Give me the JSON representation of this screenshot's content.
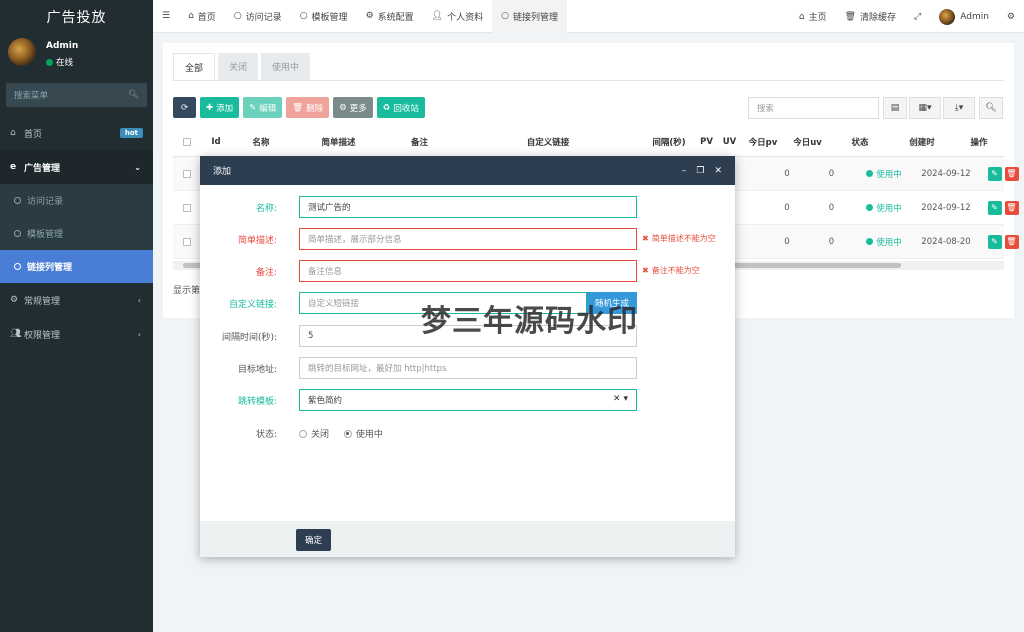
{
  "sidebar": {
    "logo": "广告投放",
    "user_name": "Admin",
    "user_status": "在线",
    "search_placeholder": "搜索菜单",
    "items": [
      {
        "label": "首页",
        "badge": "hot"
      },
      {
        "label": "广告管理"
      },
      {
        "label": "常规管理"
      },
      {
        "label": "权限管理"
      }
    ],
    "sub_items": [
      "访问记录",
      "模板管理",
      "链接列管理"
    ]
  },
  "topbar": {
    "tabs": [
      "首页",
      "访问记录",
      "模板管理",
      "系统配置",
      "个人资料",
      "链接列管理"
    ],
    "right": {
      "home": "主页",
      "clear_cache": "清除缓存",
      "user": "Admin"
    }
  },
  "content": {
    "tabs": [
      "全部",
      "关闭",
      "使用中"
    ],
    "toolbar": {
      "add": "添加",
      "edit": "编辑",
      "delete": "删除",
      "more": "更多",
      "recycle": "回收站"
    },
    "search_placeholder": "搜索",
    "columns": [
      "Id",
      "名称",
      "简单描述",
      "备注",
      "自定义链接",
      "间隔(秒)",
      "PV",
      "UV",
      "今日pv",
      "今日uv",
      "状态",
      "创建时",
      "操作"
    ],
    "rows": [
      {
        "today_pv": "0",
        "today_uv": "0",
        "status": "使用中",
        "created": "2024-09-12"
      },
      {
        "today_pv": "0",
        "today_uv": "0",
        "status": "使用中",
        "created": "2024-09-12"
      },
      {
        "today_pv": "0",
        "today_uv": "0",
        "status": "使用中",
        "created": "2024-08-20"
      }
    ],
    "footer": "显示第"
  },
  "modal": {
    "title": "添加",
    "fields": {
      "name": {
        "label": "名称:",
        "value": "测试广告的"
      },
      "desc": {
        "label": "简单描述:",
        "placeholder": "简单描述，展示部分信息",
        "error": "简单描述不能为空"
      },
      "remark": {
        "label": "备注:",
        "placeholder": "备注信息",
        "error": "备注不能为空"
      },
      "custom_link": {
        "label": "自定义链接:",
        "placeholder": "自定义短链接",
        "button": "随机生成"
      },
      "interval": {
        "label": "间隔时间(秒):",
        "value": "5"
      },
      "target": {
        "label": "目标地址:",
        "placeholder": "跳转的目标网址，最好加 http|https"
      },
      "template": {
        "label": "跳转模板:",
        "value": "紫色简约"
      },
      "status": {
        "label": "状态:",
        "options": [
          "关闭",
          "使用中"
        ],
        "selected": "使用中"
      }
    },
    "ok": "确定"
  },
  "watermark": "梦三年源码水印",
  "colors": {
    "sidebar": "#222d32",
    "active": "#4a7dd6",
    "green": "#18bc9c",
    "red": "#e74c3c",
    "modal_header": "#2c3e50"
  }
}
